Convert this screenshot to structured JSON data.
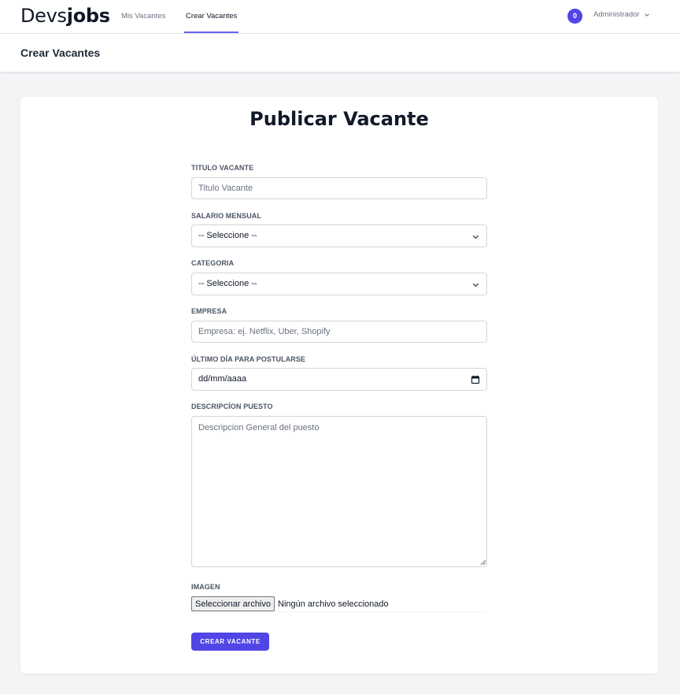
{
  "navbar": {
    "logo_part1": "Devs",
    "logo_part2": "jobs",
    "links": [
      {
        "label": "Mis Vacantes",
        "active": false
      },
      {
        "label": "Crear Vacantes",
        "active": true
      }
    ],
    "notification_count": "0",
    "user_name": "Administrador",
    "accent_color": "#4f46e5"
  },
  "header": {
    "title": "Crear Vacantes"
  },
  "form": {
    "title": "Publicar Vacante",
    "titulo": {
      "label": "Titulo Vacante",
      "placeholder": "Titulo Vacante"
    },
    "salario": {
      "label": "Salario Mensual",
      "value": "-- Seleccione --"
    },
    "categoria": {
      "label": "Categoria",
      "value": "-- Seleccione --"
    },
    "empresa": {
      "label": "Empresa",
      "placeholder": "Empresa: ej. Netflix, Uber, Shopify"
    },
    "ultimo_dia": {
      "label": "Último Día para Postularse",
      "value": "dd/mm/aaaa"
    },
    "descripcion": {
      "label": "Descripcíon Puesto",
      "placeholder": "Descripcion General del puesto"
    },
    "imagen": {
      "label": "Imagen",
      "button_label": "Seleccionar archivo",
      "status": "Ningún archivo seleccionado"
    },
    "submit_label": "CREAR VACANTE"
  }
}
